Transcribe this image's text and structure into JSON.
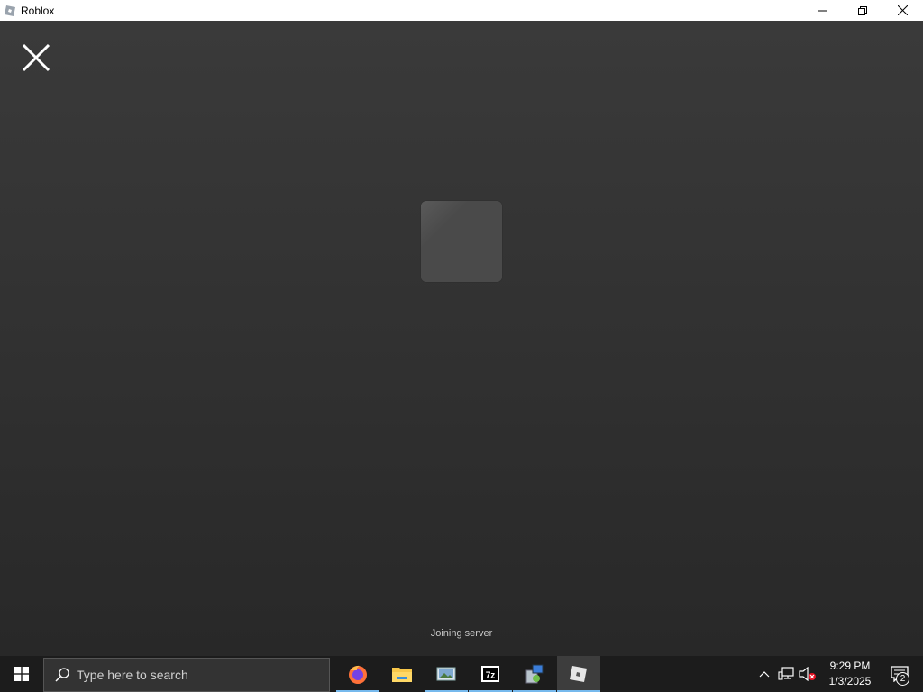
{
  "window": {
    "title": "Roblox"
  },
  "game": {
    "status_text": "Joining server"
  },
  "taskbar": {
    "search_placeholder": "Type here to search",
    "apps": [
      {
        "name": "firefox-icon",
        "running": true
      },
      {
        "name": "file-explorer-icon",
        "running": false
      },
      {
        "name": "photo-viewer-icon",
        "running": true
      },
      {
        "name": "7zip-icon",
        "running": true
      },
      {
        "name": "installer-icon",
        "running": true
      },
      {
        "name": "roblox-icon",
        "running": true,
        "active": true
      }
    ],
    "clock": {
      "time": "9:29 PM",
      "date": "1/3/2025"
    },
    "notification_count": "2"
  },
  "colors": {
    "taskbar_bg": "#1c1c1c",
    "accent": "#76b9ed",
    "game_bg": "#323232"
  }
}
